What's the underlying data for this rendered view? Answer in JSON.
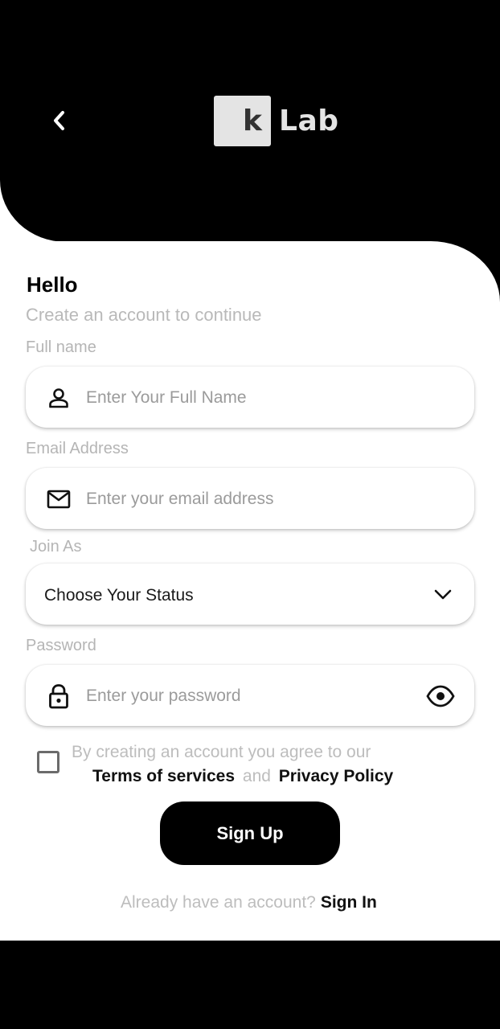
{
  "header": {
    "logo_mark": "k",
    "logo_text": "Lab"
  },
  "main": {
    "title": "Hello",
    "subtitle": "Create an account to continue",
    "full_name": {
      "label": "Full name",
      "placeholder": "Enter Your Full Name"
    },
    "email": {
      "label": "Email Address",
      "placeholder": "Enter your email address"
    },
    "join_as": {
      "label": "Join As",
      "selected": "Choose Your Status"
    },
    "password": {
      "label": "Password",
      "placeholder": "Enter your password"
    },
    "agreement": {
      "line1": "By creating an account you agree to our",
      "terms": "Terms of services",
      "and": "and",
      "privacy": "Privacy Policy"
    },
    "signup_label": "Sign Up",
    "signin_prompt": "Already have an account?",
    "signin_label": "Sign In"
  },
  "colors": {
    "background": "#000000",
    "surface": "#ffffff",
    "muted_text": "#bdbdbd",
    "logo_gray": "#e4e4e4"
  },
  "icons": {
    "back": "chevron-left-icon",
    "full_name": "user-icon",
    "email": "mail-icon",
    "join_as": "chevron-down-icon",
    "password": "lock-icon",
    "toggle_password": "eye-icon"
  }
}
